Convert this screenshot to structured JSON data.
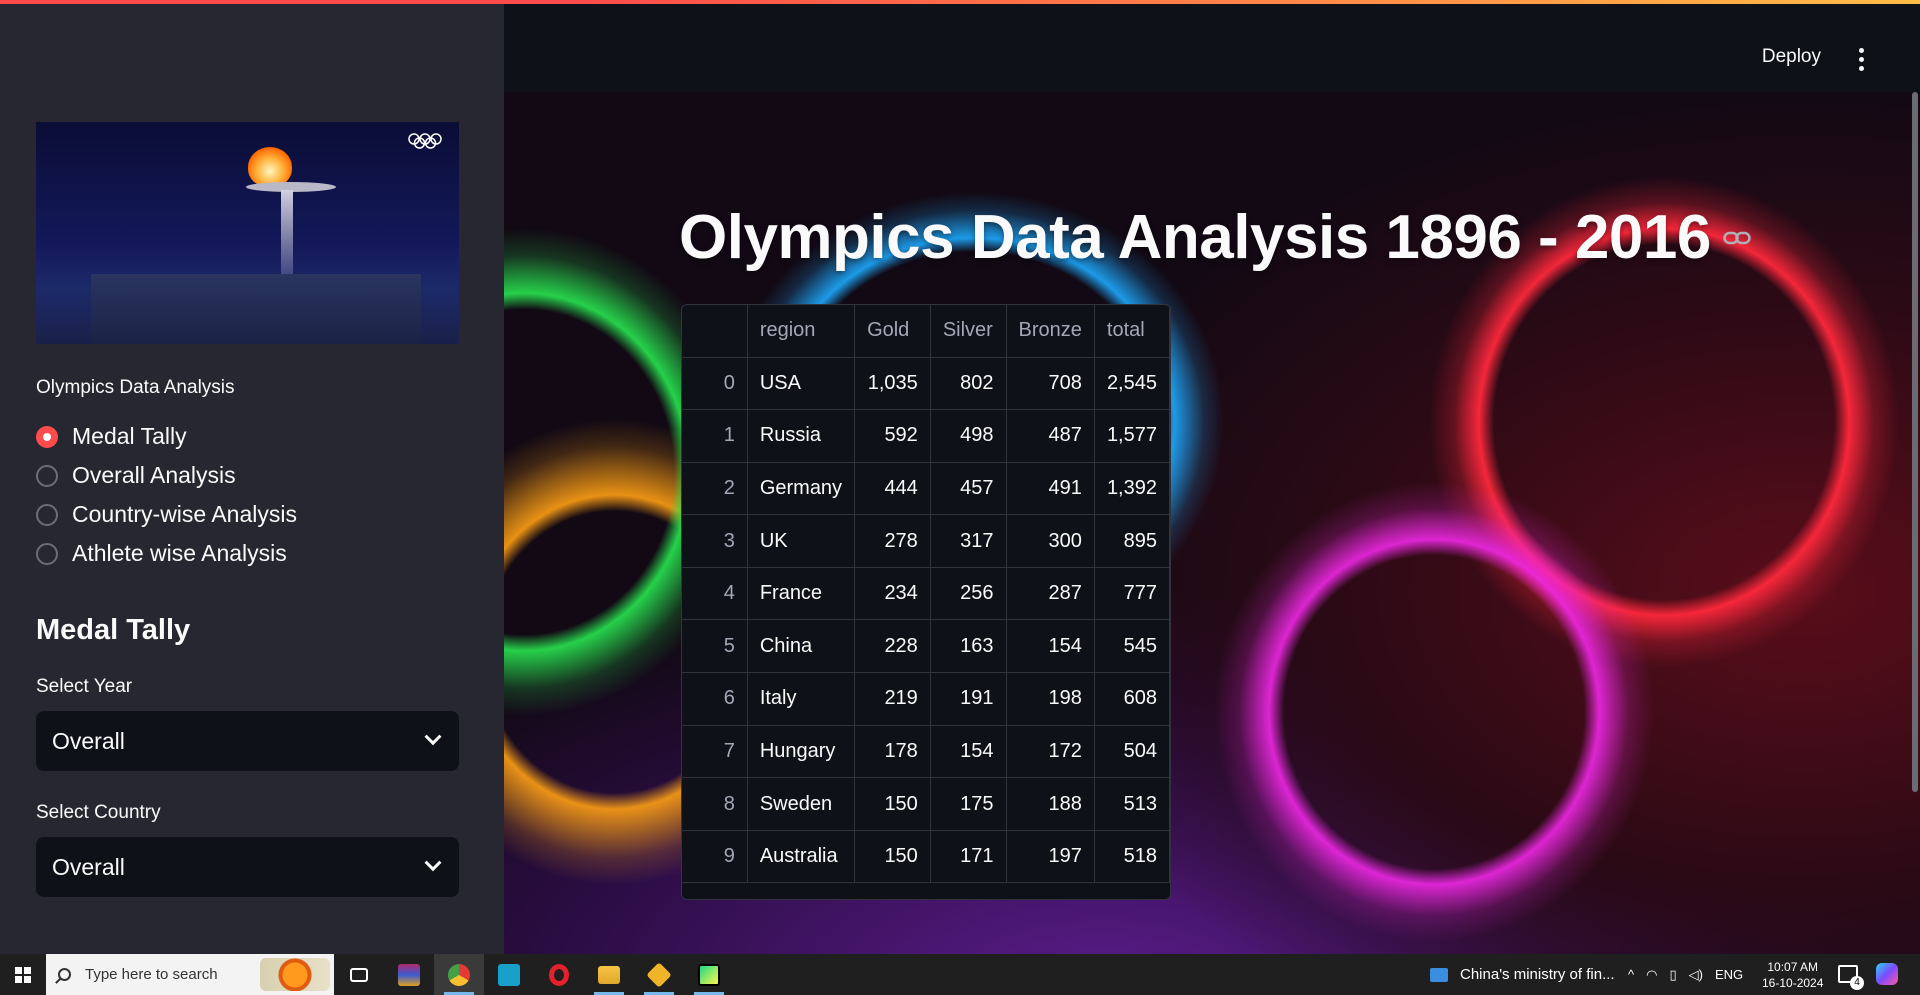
{
  "header": {
    "deploy_label": "Deploy"
  },
  "sidebar": {
    "radio_caption": "Olympics Data Analysis",
    "options": [
      "Medal Tally",
      "Overall Analysis",
      "Country-wise Analysis",
      "Athlete wise Analysis"
    ],
    "selected_option": "Medal Tally",
    "section_title": "Medal Tally",
    "year_label": "Select Year",
    "year_value": "Overall",
    "country_label": "Select Country",
    "country_value": "Overall"
  },
  "main": {
    "title": "Olympics Data Analysis 1896 - 2016",
    "table": {
      "columns": [
        "",
        "region",
        "Gold",
        "Silver",
        "Bronze",
        "total"
      ],
      "rows": [
        [
          "0",
          "USA",
          "1,035",
          "802",
          "708",
          "2,545"
        ],
        [
          "1",
          "Russia",
          "592",
          "498",
          "487",
          "1,577"
        ],
        [
          "2",
          "Germany",
          "444",
          "457",
          "491",
          "1,392"
        ],
        [
          "3",
          "UK",
          "278",
          "317",
          "300",
          "895"
        ],
        [
          "4",
          "France",
          "234",
          "256",
          "287",
          "777"
        ],
        [
          "5",
          "China",
          "228",
          "163",
          "154",
          "545"
        ],
        [
          "6",
          "Italy",
          "219",
          "191",
          "198",
          "608"
        ],
        [
          "7",
          "Hungary",
          "178",
          "154",
          "172",
          "504"
        ],
        [
          "8",
          "Sweden",
          "150",
          "175",
          "188",
          "513"
        ],
        [
          "9",
          "Australia",
          "150",
          "171",
          "197",
          "518"
        ]
      ]
    }
  },
  "taskbar": {
    "search_placeholder": "Type here to search",
    "news_text": "China's ministry of fin...",
    "language": "ENG",
    "time": "10:07 AM",
    "date": "16-10-2024",
    "notification_count": "4"
  },
  "colors": {
    "accent": "#ff4b4b",
    "sidebar_bg": "#262730",
    "app_bg": "#0e1117"
  },
  "icons": {
    "olympic_rings": "olympic-rings-icon",
    "link": "link-icon",
    "chevron": "chevron-down-icon",
    "menu": "more-vert-icon"
  }
}
